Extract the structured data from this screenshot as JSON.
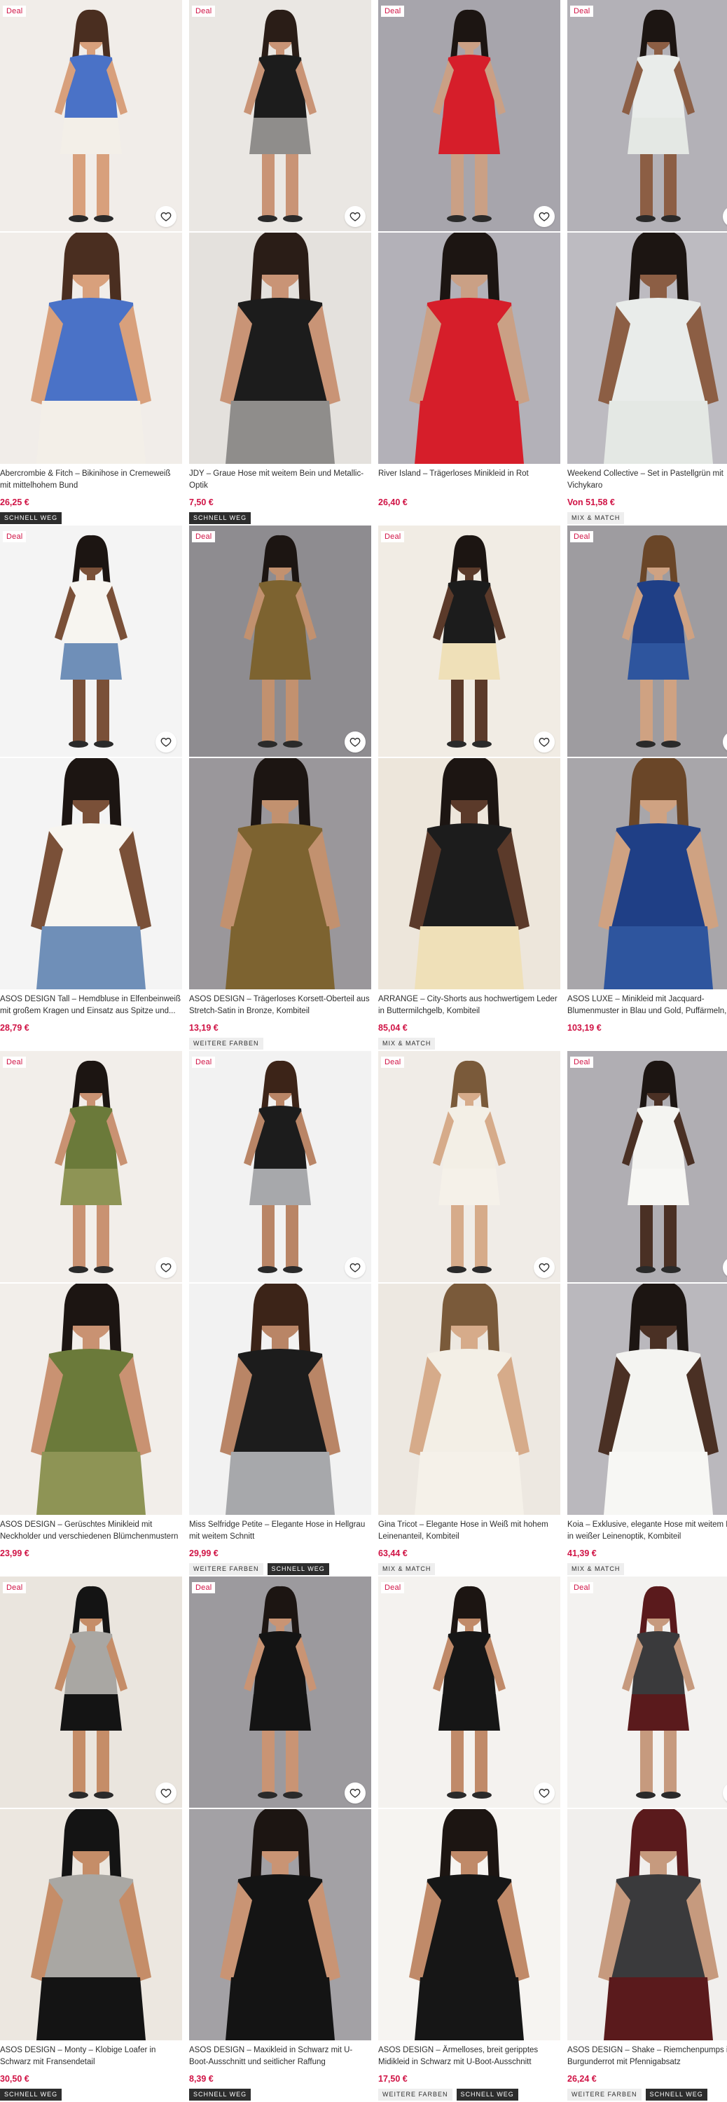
{
  "labels": {
    "deal": "Deal"
  },
  "products": [
    {
      "title": "Abercrombie & Fitch – Bikinihose in Cremeweiß mit mittelhohem Bund",
      "price": "26,25 €",
      "tags": [
        "SCHNELL WEG"
      ],
      "bg1": "#f1ede9",
      "bg2": "#f1ede9",
      "skin": "#d8a07c",
      "top": "#4a72c7",
      "bottom": "#f3efe8",
      "hair": "#4a2e20"
    },
    {
      "title": "JDY – Graue Hose mit weitem Bein und Metallic-Optik",
      "price": "7,50 €",
      "tags": [
        "SCHNELL WEG"
      ],
      "bg1": "#eae7e3",
      "bg2": "#e4e1dd",
      "skin": "#c99476",
      "top": "#1c1c1c",
      "bottom": "#8f8d8b",
      "hair": "#2a1d17"
    },
    {
      "title": "River Island – Trägerloses Minikleid in Rot",
      "price": "26,40 €",
      "tags": [],
      "bg1": "#a7a5ac",
      "bg2": "#b3b1b8",
      "skin": "#caa085",
      "top": "#d61e2a",
      "bottom": "#d61e2a",
      "hair": "#1c1512"
    },
    {
      "title": "Weekend Collective – Set in Pastellgrün mit Vichykaro",
      "price": "Von 51,58 €",
      "tags": [
        "MIX & MATCH"
      ],
      "bg1": "#b3b1b7",
      "bg2": "#bdbbc1",
      "skin": "#8c5e44",
      "top": "#e9ecea",
      "bottom": "#e4e8e4",
      "hair": "#1c1512"
    },
    {
      "title": "ASOS DESIGN Tall – Hemdbluse in Elfenbeinweiß mit großem Kragen und Einsatz aus Spitze und...",
      "price": "28,79 €",
      "tags": [],
      "bg1": "#f4f4f4",
      "bg2": "#f4f4f4",
      "skin": "#7a5038",
      "top": "#f7f5f0",
      "bottom": "#6f8fb8",
      "hair": "#1c1512"
    },
    {
      "title": "ASOS DESIGN – Trägerloses Korsett-Oberteil aus Stretch-Satin in Bronze, Kombiteil",
      "price": "13,19 €",
      "tags": [
        "WEITERE FARBEN"
      ],
      "bg1": "#8e8c90",
      "bg2": "#9a979b",
      "skin": "#c2916f",
      "top": "#7d6330",
      "bottom": "#7d6330",
      "hair": "#1c1512"
    },
    {
      "title": "ARRANGE – City-Shorts aus hochwertigem Leder in Buttermilchgelb, Kombiteil",
      "price": "85,04 €",
      "tags": [
        "MIX & MATCH"
      ],
      "bg1": "#f1ece4",
      "bg2": "#ede6db",
      "skin": "#5b3a2a",
      "top": "#1c1c1c",
      "bottom": "#efe0b8",
      "hair": "#1c1512"
    },
    {
      "title": "ASOS LUXE – Minikleid mit Jacquard-Blumenmuster in Blau und Gold, Puffärmeln, Kragen und verzie...",
      "price": "103,19 €",
      "tags": [],
      "bg1": "#9e9ca0",
      "bg2": "#a8a6aa",
      "skin": "#cfa282",
      "top": "#1f3f86",
      "bottom": "#2e559e",
      "hair": "#6a4628"
    },
    {
      "title": "ASOS DESIGN – Gerüschtes Minikleid mit Neckholder und verschiedenen Blümchenmustern",
      "price": "23,99 €",
      "tags": [],
      "bg1": "#f2eeea",
      "bg2": "#f2eeea",
      "skin": "#c99272",
      "top": "#6b7a3a",
      "bottom": "#8e9455",
      "hair": "#1c1512"
    },
    {
      "title": "Miss Selfridge Petite – Elegante Hose in Hellgrau mit weitem Schnitt",
      "price": "29,99 €",
      "tags": [
        "WEITERE FARBEN",
        "SCHNELL WEG"
      ],
      "bg1": "#f2f2f2",
      "bg2": "#f2f2f2",
      "skin": "#b98566",
      "top": "#1c1c1c",
      "bottom": "#a7a8ab",
      "hair": "#3c2418"
    },
    {
      "title": "Gina Tricot – Elegante Hose in Weiß mit hohem Leinenanteil, Kombiteil",
      "price": "63,44 €",
      "tags": [
        "MIX & MATCH"
      ],
      "bg1": "#f0ece7",
      "bg2": "#ede8e1",
      "skin": "#d6ab8a",
      "top": "#f3efe6",
      "bottom": "#f5f1e9",
      "hair": "#7a5a3a"
    },
    {
      "title": "Koia – Exklusive, elegante Hose mit weitem Bein in weißer Leinenoptik, Kombiteil",
      "price": "41,39 €",
      "tags": [
        "MIX & MATCH"
      ],
      "bg1": "#b0aeb3",
      "bg2": "#bab8bd",
      "skin": "#4a3024",
      "top": "#f4f4f1",
      "bottom": "#f7f7f4",
      "hair": "#1c1512"
    },
    {
      "title": "ASOS DESIGN – Monty – Klobige Loafer in Schwarz mit Fransendetail",
      "price": "30,50 €",
      "tags": [
        "SCHNELL WEG"
      ],
      "bg1": "#eae5de",
      "bg2": "#ece7e0",
      "skin": "#c58d68",
      "top": "#a9a7a3",
      "bottom": "#141414",
      "hair": "#141414"
    },
    {
      "title": "ASOS DESIGN – Maxikleid in Schwarz mit U-Boot-Ausschnitt und seitlicher Raffung",
      "price": "8,39 €",
      "tags": [
        "SCHNELL WEG"
      ],
      "bg1": "#9c9a9e",
      "bg2": "#a3a1a5",
      "skin": "#c99474",
      "top": "#141414",
      "bottom": "#141414",
      "hair": "#1c1512"
    },
    {
      "title": "ASOS DESIGN – Ärmelloses, breit geripptes Midikleid in Schwarz mit U-Boot-Ausschnitt",
      "price": "17,50 €",
      "tags": [
        "WEITERE FARBEN",
        "SCHNELL WEG"
      ],
      "bg1": "#f4f2ef",
      "bg2": "#f6f4f1",
      "skin": "#c08a69",
      "top": "#161616",
      "bottom": "#161616",
      "hair": "#1c1512"
    },
    {
      "title": "ASOS DESIGN – Shake – Riemchenpumps in Burgunderrot mit Pfennigabsatz",
      "price": "26,24 €",
      "tags": [
        "WEITERE FARBEN",
        "SCHNELL WEG"
      ],
      "bg1": "#f3f2f0",
      "bg2": "#f1efed",
      "skin": "#c69a7e",
      "top": "#3a3a3c",
      "bottom": "#5a1a1c",
      "hair": "#5a1a1c"
    }
  ]
}
